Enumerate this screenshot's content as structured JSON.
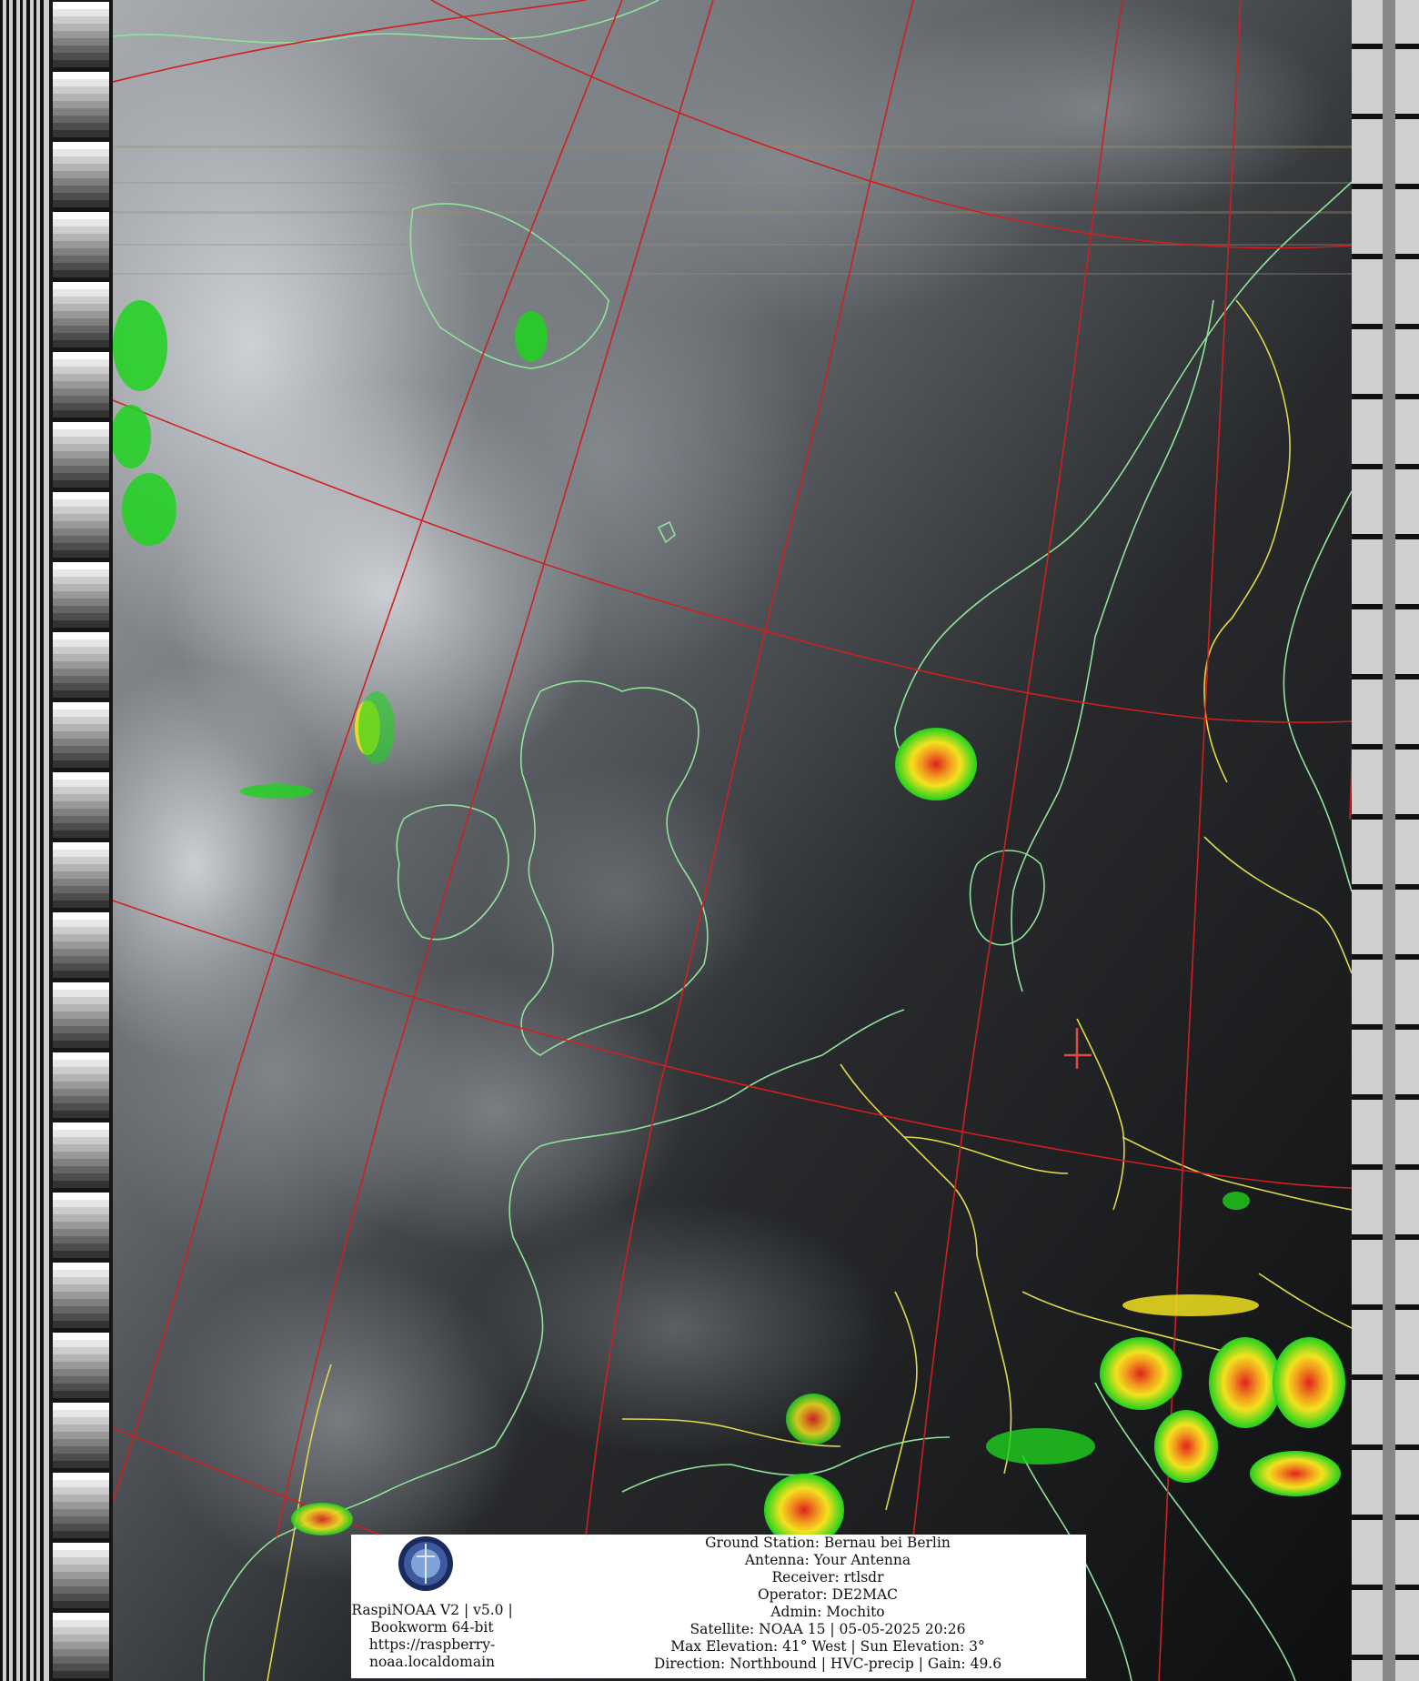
{
  "palette": {
    "ocean": "#0d0f10",
    "cloud_light": "#c9ccd0",
    "cloud_mid": "#7d8287",
    "coast": "#8fe39b",
    "border": "#e0d84a",
    "grid": "#d11f1f",
    "precip_green": "#1ed21e",
    "precip_yellow": "#f2e21e",
    "precip_red": "#e0231e"
  },
  "icons": {
    "logo": "raspinoaa-seal-icon",
    "station_marker": "plus-marker-icon"
  },
  "info": {
    "left": {
      "line1": "RaspiNOAA V2 | v5.0 |",
      "line2": "Bookworm 64-bit",
      "line3": "https://raspberry-",
      "line4": "noaa.localdomain"
    },
    "right": {
      "ground_station": "Ground Station: Bernau bei Berlin",
      "antenna": "Antenna: Your Antenna",
      "receiver": "Receiver: rtlsdr",
      "operator": "Operator: DE2MAC",
      "admin": "Admin: Mochito",
      "satellite": "Satellite: NOAA 15 | 05-05-2025 20:26",
      "elevation": "Max Elevation: 41° West | Sun Elevation: 3°",
      "direction": "Direction: Northbound | HVC-precip | Gain: 49.6"
    }
  }
}
